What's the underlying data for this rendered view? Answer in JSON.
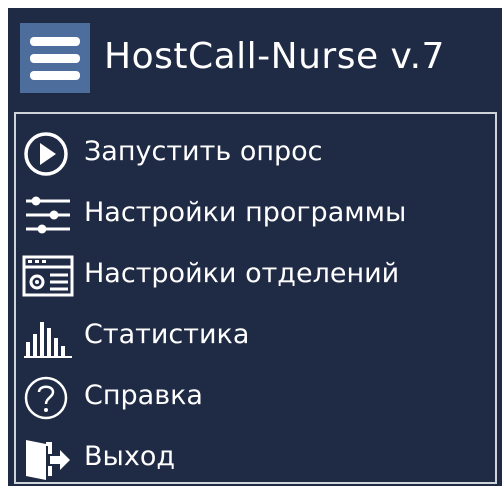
{
  "app": {
    "title": "HostCall-Nurse v.7"
  },
  "menu": {
    "items": [
      {
        "label": "Запустить опрос",
        "icon": "play-circle-icon"
      },
      {
        "label": "Настройки программы",
        "icon": "sliders-icon"
      },
      {
        "label": "Настройки отделений",
        "icon": "window-settings-icon"
      },
      {
        "label": "Статистика",
        "icon": "bar-chart-icon"
      },
      {
        "label": "Справка",
        "icon": "help-circle-icon"
      },
      {
        "label": "Выход",
        "icon": "exit-door-icon"
      }
    ]
  },
  "colors": {
    "background": "#1f2a44",
    "menu_button": "#4d6e9c",
    "text": "#ffffff",
    "menu_border": "#cfd3da"
  }
}
